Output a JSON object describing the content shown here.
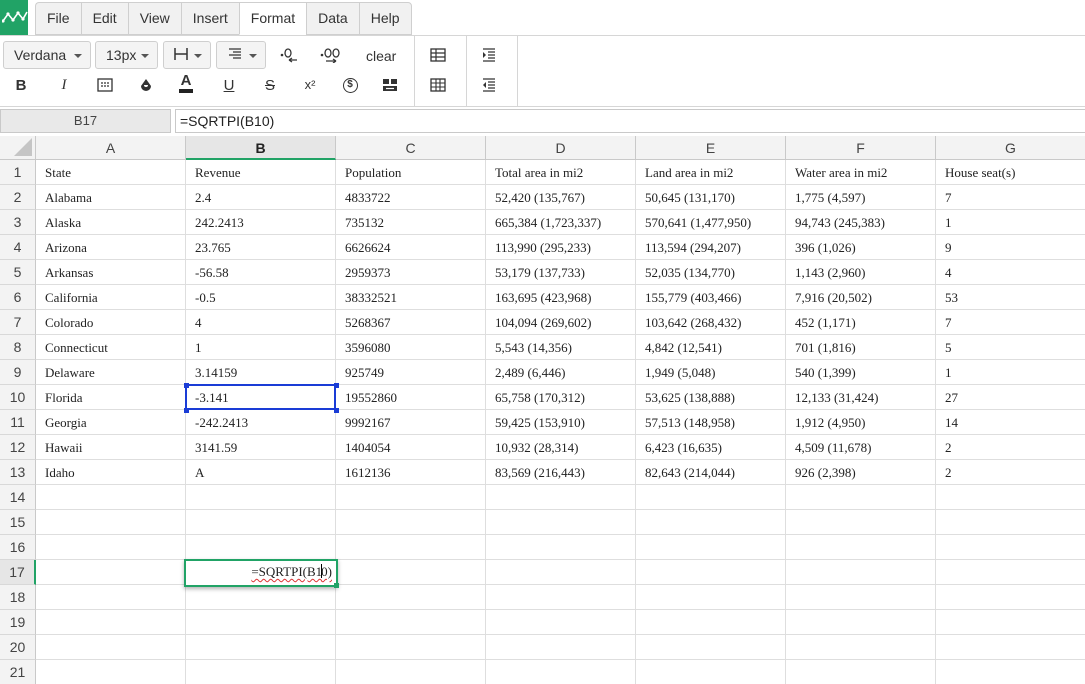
{
  "menu": {
    "items": [
      "File",
      "Edit",
      "View",
      "Insert",
      "Format",
      "Data",
      "Help"
    ],
    "active": "Format"
  },
  "toolbar": {
    "font_family": "Verdana",
    "font_size": "13px",
    "clear_label": "clear",
    "superscript_glyph": "x²",
    "bold_glyph": "B",
    "italic_glyph": "I",
    "underline_glyph": "U",
    "strike_glyph": "S",
    "font_color_glyph": "A",
    "currency_glyph": "$"
  },
  "formula_bar": {
    "cell_ref": "B17",
    "formula": "=SQRTPI(B10)"
  },
  "grid": {
    "columns": [
      "A",
      "B",
      "C",
      "D",
      "E",
      "F",
      "G"
    ],
    "selected_column": "B",
    "row_numbers": [
      "1",
      "2",
      "3",
      "4",
      "5",
      "6",
      "7",
      "8",
      "9",
      "10",
      "11",
      "12",
      "13",
      "14",
      "15",
      "16",
      "17",
      "18",
      "19",
      "20",
      "21"
    ],
    "selected_row": "17",
    "rows": [
      [
        "State",
        "Revenue",
        "Population",
        "Total area in mi2",
        "Land area in mi2",
        "Water area in mi2",
        "House seat(s)"
      ],
      [
        "Alabama",
        "2.4",
        "4833722",
        "52,420 (135,767)",
        "50,645 (131,170)",
        "1,775 (4,597)",
        "7"
      ],
      [
        "Alaska",
        "242.2413",
        "735132",
        "665,384 (1,723,337)",
        "570,641 (1,477,950)",
        "94,743 (245,383)",
        "1"
      ],
      [
        "Arizona",
        "23.765",
        "6626624",
        "113,990 (295,233)",
        "113,594 (294,207)",
        "396 (1,026)",
        "9"
      ],
      [
        "Arkansas",
        "-56.58",
        "2959373",
        "53,179 (137,733)",
        "52,035 (134,770)",
        "1,143 (2,960)",
        "4"
      ],
      [
        "California",
        "-0.5",
        "38332521",
        "163,695 (423,968)",
        "155,779 (403,466)",
        "7,916 (20,502)",
        "53"
      ],
      [
        "Colorado",
        "4",
        "5268367",
        "104,094 (269,602)",
        "103,642 (268,432)",
        "452 (1,171)",
        "7"
      ],
      [
        "Connecticut",
        "1",
        "3596080",
        "5,543 (14,356)",
        "4,842 (12,541)",
        "701 (1,816)",
        "5"
      ],
      [
        "Delaware",
        "3.14159",
        "925749",
        "2,489 (6,446)",
        "1,949 (5,048)",
        "540 (1,399)",
        "1"
      ],
      [
        "Florida",
        "-3.141",
        "19552860",
        "65,758 (170,312)",
        "53,625 (138,888)",
        "12,133 (31,424)",
        "27"
      ],
      [
        "Georgia",
        "-242.2413",
        "9992167",
        "59,425 (153,910)",
        "57,513 (148,958)",
        "1,912 (4,950)",
        "14"
      ],
      [
        "Hawaii",
        "3141.59",
        "1404054",
        "10,932 (28,314)",
        "6,423 (16,635)",
        "4,509 (11,678)",
        "2"
      ],
      [
        "Idaho",
        "A",
        "1612136",
        "83,569 (216,443)",
        "82,643 (214,044)",
        "926 (2,398)",
        "2"
      ]
    ],
    "editing_cell": {
      "ref": "B17",
      "text_before_cursor": "=SQRTPI(B1",
      "text_after_cursor": "0)"
    }
  }
}
